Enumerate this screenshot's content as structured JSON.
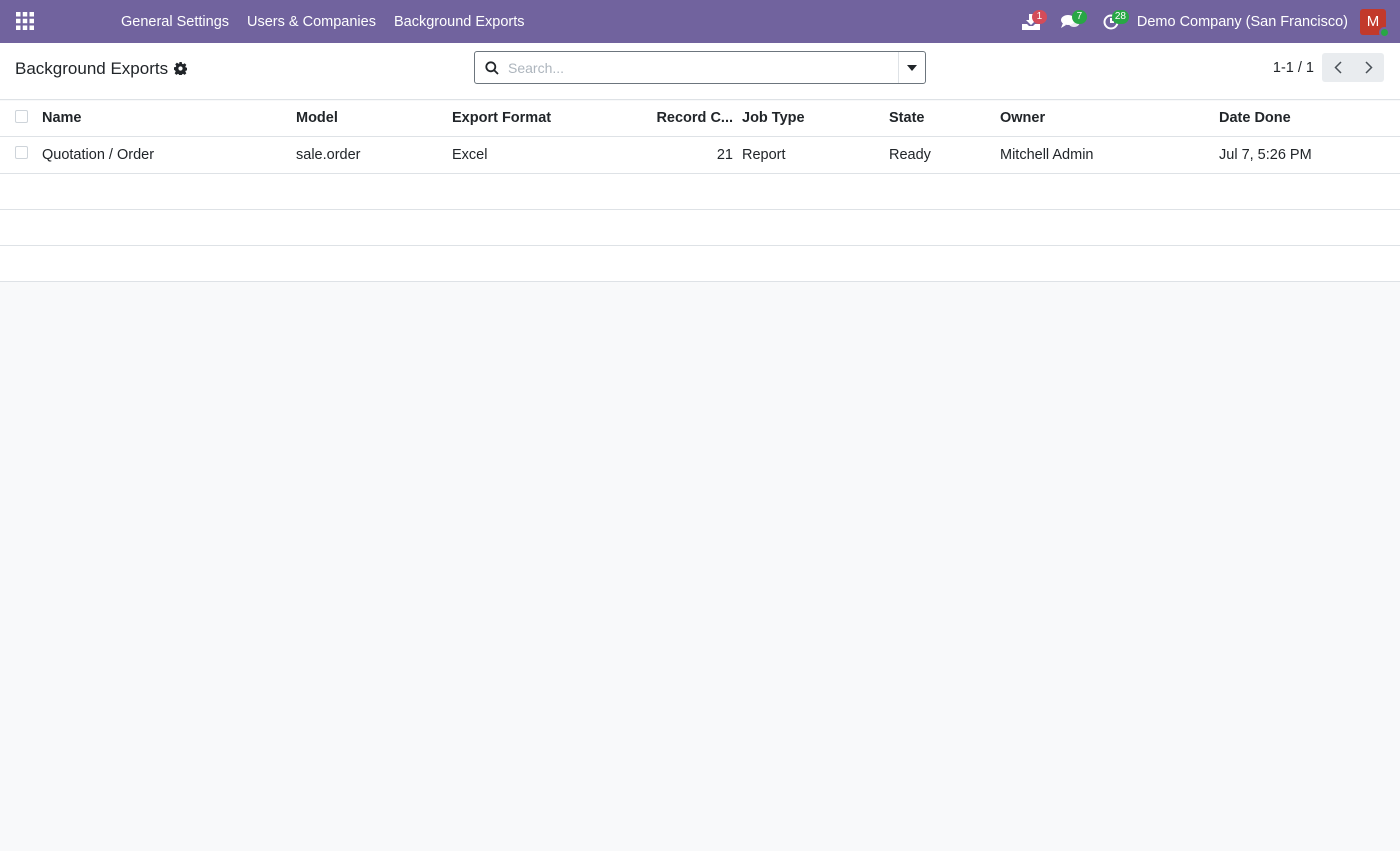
{
  "navbar": {
    "menu": [
      "General Settings",
      "Users & Companies",
      "Background Exports"
    ],
    "badges": {
      "exports": "1",
      "messages": "7",
      "activities": "28"
    },
    "company": "Demo Company (San Francisco)",
    "avatar_initial": "M"
  },
  "control_panel": {
    "title": "Background Exports",
    "search_placeholder": "Search...",
    "pager": "1-1 / 1"
  },
  "table": {
    "columns": [
      "Name",
      "Model",
      "Export Format",
      "Record C...",
      "Job Type",
      "State",
      "Owner",
      "Date Done"
    ],
    "rows": [
      {
        "name": "Quotation / Order",
        "model": "sale.order",
        "export_format": "Excel",
        "record_count": "21",
        "job_type": "Report",
        "state": "Ready",
        "owner": "Mitchell Admin",
        "date_done": "Jul 7, 5:26 PM"
      }
    ]
  },
  "colors": {
    "navbar": "#71639e",
    "badge_red": "#d44c59",
    "badge_green": "#28a745",
    "avatar": "#c2392b"
  }
}
